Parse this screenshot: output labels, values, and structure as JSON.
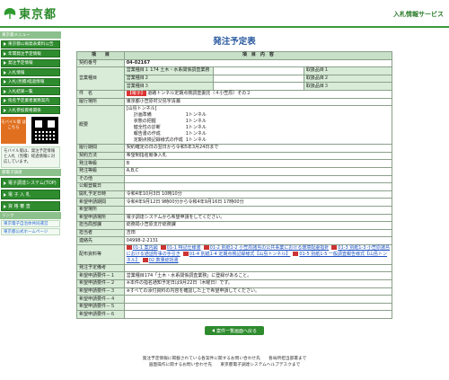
{
  "header": {
    "logo_text": "東京都",
    "service_title": "入札情報サービス",
    "colors": {
      "brand_green": "#2e8b2e",
      "accent_blue": "#2a5aa0",
      "badge_red": "#dd3333"
    }
  },
  "sidebar": {
    "section1_heading": "東京都メニュー",
    "menu": [
      "東京都公報発表資料公告",
      "年間発注予定情報",
      "発注予定情報",
      "入札情報",
      "入札(見積)経過情報",
      "入札結果一覧",
      "指名予定業者業務案内",
      "入札参加資格関係"
    ],
    "mobile_label": "モバイル版\nはこちら",
    "mobile_note": "モバイル版は、発注予定情報と入札（見積）経過情報に対応しています。",
    "section2_heading": "都電子調達",
    "big_buttons": [
      "電子調達システム(TOP)",
      "電 子 入 札",
      "資 格 審 査"
    ],
    "section3_heading": "リンク",
    "links": [
      "東京電子自治体共同運営",
      "東京都公式ホームページ"
    ]
  },
  "main": {
    "title": "発注予定表",
    "headers": {
      "item": "項　　目",
      "content": "項　目　内　容"
    },
    "contract_no_label": "契約番号",
    "contract_no": "04-02167",
    "business": {
      "label": "営業種目",
      "rows": [
        {
          "cat": "営業種目１",
          "val": "174 土木・水系関係調査業務",
          "rank_label": "取扱品目１"
        },
        {
          "cat": "営業種目２",
          "val": "",
          "rank_label": "取扱品目２"
        },
        {
          "cat": "営業種目３",
          "val": "",
          "rank_label": "取扱品目３"
        }
      ]
    },
    "subject_label": "件　名",
    "subject_badge": "【電子】",
    "subject": "道路トンネル定期点検調査委託（４小笠原）その２",
    "location_label": "履行場所",
    "location": "東京都小笠原村父島字清瀬",
    "outline_label": "概要",
    "outline": {
      "head": "[山島トンネル]",
      "items": [
        {
          "name": "計画準備",
          "val": "1トンネル"
        },
        {
          "name": "状態の把握",
          "val": "1トンネル"
        },
        {
          "name": "健全性の診断",
          "val": "1トンネル"
        },
        {
          "name": "報告書の作成",
          "val": "1トンネル"
        },
        {
          "name": "定期点検記録様式の作成",
          "val": "1トンネル"
        }
      ]
    },
    "rows": [
      {
        "label": "履行期間",
        "value": "契約確定の日の翌日から令和5年3月24日まで"
      },
      {
        "label": "契約方法",
        "value": "希望制指名競争入札"
      },
      {
        "label": "発注等級",
        "value": "B"
      },
      {
        "label": "発注等級",
        "value": "A,B,C"
      },
      {
        "label": "その他",
        "value": ""
      },
      {
        "label": "公報登載日",
        "value": ""
      },
      {
        "label": "開札予定日時",
        "value": "令和4年10月3日 10時10分"
      },
      {
        "label": "希望申請期間",
        "value": "令和4年9月12日 9時00分から令和4年9月16日 17時00分"
      },
      {
        "label": "希望場所",
        "value": ""
      },
      {
        "label": "希望申請場所",
        "value": "電子調達システムから希望申請をしてください。"
      },
      {
        "label": "担当局部課",
        "value": "総務局小笠原支庁総務課"
      },
      {
        "label": "担当者",
        "value": "吉田"
      },
      {
        "label": "連絡先",
        "value": "04998-2-2131"
      }
    ],
    "docs_label": "配布資料等",
    "docs": [
      "01-1 案内図",
      "01-1 特記仕様書",
      "01-2 別紙1-2 小笠原諸島の公共事業における環境配慮指針",
      "01-3 別紙1-3 小笠原諸島における通話所事の手引き",
      "01-4 別紙1-4 定期点検記録様式【山島トンネル】",
      "01-5 別紙1-5 一般調査報告様式【山島トンネル】",
      "02 数量総括書"
    ],
    "notes": [
      {
        "label": "発注予定備考",
        "value": ""
      },
      {
        "label": "希望申請要件－１",
        "value": "営業種目174「土木・水系関係調査業務」に登録があること。"
      },
      {
        "label": "希望申請要件－２",
        "value": "※本件の指名通知予定日は9月22日（木曜日）です。"
      },
      {
        "label": "希望申請要件－３",
        "value": "※すべての添付資料の内容を確認した上で希望申請してください。"
      },
      {
        "label": "希望申請要件－４",
        "value": ""
      },
      {
        "label": "希望申請要件－５",
        "value": ""
      },
      {
        "label": "希望申請要件－６",
        "value": ""
      }
    ],
    "back_button": "案件一覧画面へ戻る"
  },
  "footer": {
    "line1": "発注予定情報に掲載されている各案件に関するお問い合わせ先　　各局所担当部署まで",
    "line2": "画面操作に関するお問い合わせ先　　東京都電子調達システムヘルプデスクまで"
  }
}
